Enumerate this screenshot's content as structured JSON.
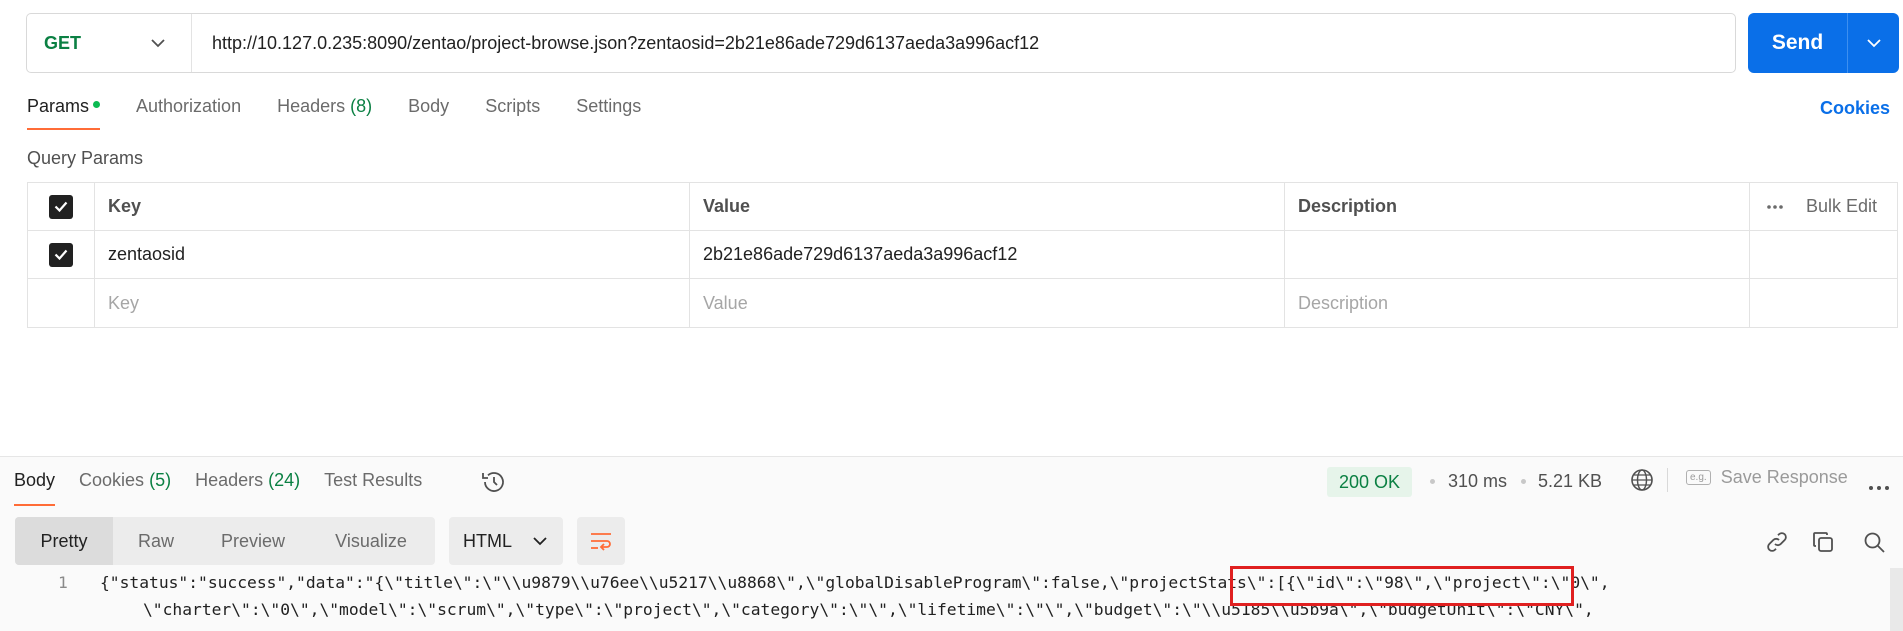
{
  "request": {
    "method": "GET",
    "url": "http://10.127.0.235:8090/zentao/project-browse.json?zentaosid=2b21e86ade729d6137aeda3a996acf12",
    "send_label": "Send"
  },
  "request_tabs": {
    "params": "Params",
    "authorization": "Authorization",
    "headers": "Headers",
    "headers_count": "(8)",
    "body": "Body",
    "scripts": "Scripts",
    "settings": "Settings",
    "cookies": "Cookies"
  },
  "query_params": {
    "title": "Query Params",
    "headers": {
      "key": "Key",
      "value": "Value",
      "description": "Description",
      "bulk_edit": "Bulk Edit"
    },
    "rows": [
      {
        "checked": true,
        "key": "zentaosid",
        "value": "2b21e86ade729d6137aeda3a996acf12",
        "description": ""
      }
    ],
    "placeholders": {
      "key": "Key",
      "value": "Value",
      "description": "Description"
    }
  },
  "response_tabs": {
    "body": "Body",
    "cookies": "Cookies",
    "cookies_count": "(5)",
    "headers": "Headers",
    "headers_count": "(24)",
    "test_results": "Test Results"
  },
  "response_meta": {
    "status": "200 OK",
    "time": "310 ms",
    "size": "5.21 KB",
    "save_response": "Save Response",
    "eg_label": "e.g."
  },
  "view": {
    "modes": [
      "Pretty",
      "Raw",
      "Preview",
      "Visualize"
    ],
    "active_mode": "Pretty",
    "format": "HTML"
  },
  "code": {
    "line_number": "1",
    "line1": "{\"status\":\"success\",\"data\":\"{\\\"title\\\":\\\"\\\\u9879\\\\u76ee\\\\u5217\\\\u8868\\\",\\\"globalDisableProgram\\\":false,\\\"projectStats\\\":[{\\\"id\\\":\\\"98\\\",\\\"project\\\":\\\"0\\\",",
    "line2": "\\\"charter\\\":\\\"0\\\",\\\"model\\\":\\\"scrum\\\",\\\"type\\\":\\\"project\\\",\\\"category\\\":\\\"\\\",\\\"lifetime\\\":\\\"\\\",\\\"budget\\\":\\\"\\\\u5185\\\\u5b9a\\\",\\\"budgetUnit\\\":\\\"CNY\\\","
  },
  "colors": {
    "accent_orange": "#ff6c37",
    "send_blue": "#0a6fe8",
    "get_green": "#0b8043",
    "highlight_red": "#e02020"
  },
  "icons": {
    "method_dropdown": "chevron-down-icon",
    "send_dropdown": "chevron-down-icon",
    "history": "history-icon",
    "globe": "globe-icon",
    "more": "more-horizontal-icon",
    "wrap": "wrap-lines-icon",
    "link": "link-icon",
    "copy": "copy-icon",
    "search": "search-icon"
  }
}
